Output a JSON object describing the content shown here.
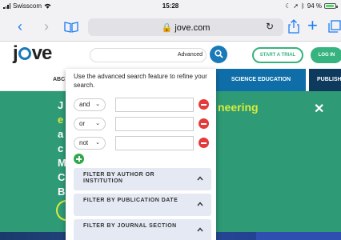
{
  "status_bar": {
    "carrier": "Swisscom",
    "time": "15:28",
    "battery_text": "94 %",
    "battery_level": 0.94
  },
  "safari": {
    "url": "jove.com"
  },
  "site_header": {
    "logo_text_j": "j",
    "logo_text_ve": "ve",
    "search_advanced_label": "Advanced",
    "start_trial_label": "START A TRIAL",
    "login_label": "LOG IN"
  },
  "nav": {
    "partial_left": "ABC",
    "science_education": "SCIENCE EDUCATION",
    "publish_partial": "PUBLISH"
  },
  "hero": {
    "title_partial": "neering",
    "left_chars": [
      "J",
      "e",
      "a",
      "c",
      "M",
      "C",
      "B"
    ]
  },
  "advanced_search": {
    "intro": "Use the advanced search feature to refine your search.",
    "criteria": [
      {
        "operator": "and",
        "value": ""
      },
      {
        "operator": "or",
        "value": ""
      },
      {
        "operator": "not",
        "value": ""
      }
    ],
    "filters": [
      {
        "label": "FILTER BY AUTHOR OR INSTITUTION"
      },
      {
        "label": "FILTER BY PUBLICATION DATE"
      },
      {
        "label": "FILTER BY JOURNAL SECTION"
      }
    ]
  },
  "colors": {
    "safari_blue": "#1a7cf5",
    "jove_blue": "#1a7ab8",
    "hero_green": "#2e9a76",
    "accent_green": "#36b37e",
    "hero_title_yellow": "#d7ed3a",
    "remove_red": "#e33a3a",
    "filter_bg": "#e4e9f3"
  }
}
